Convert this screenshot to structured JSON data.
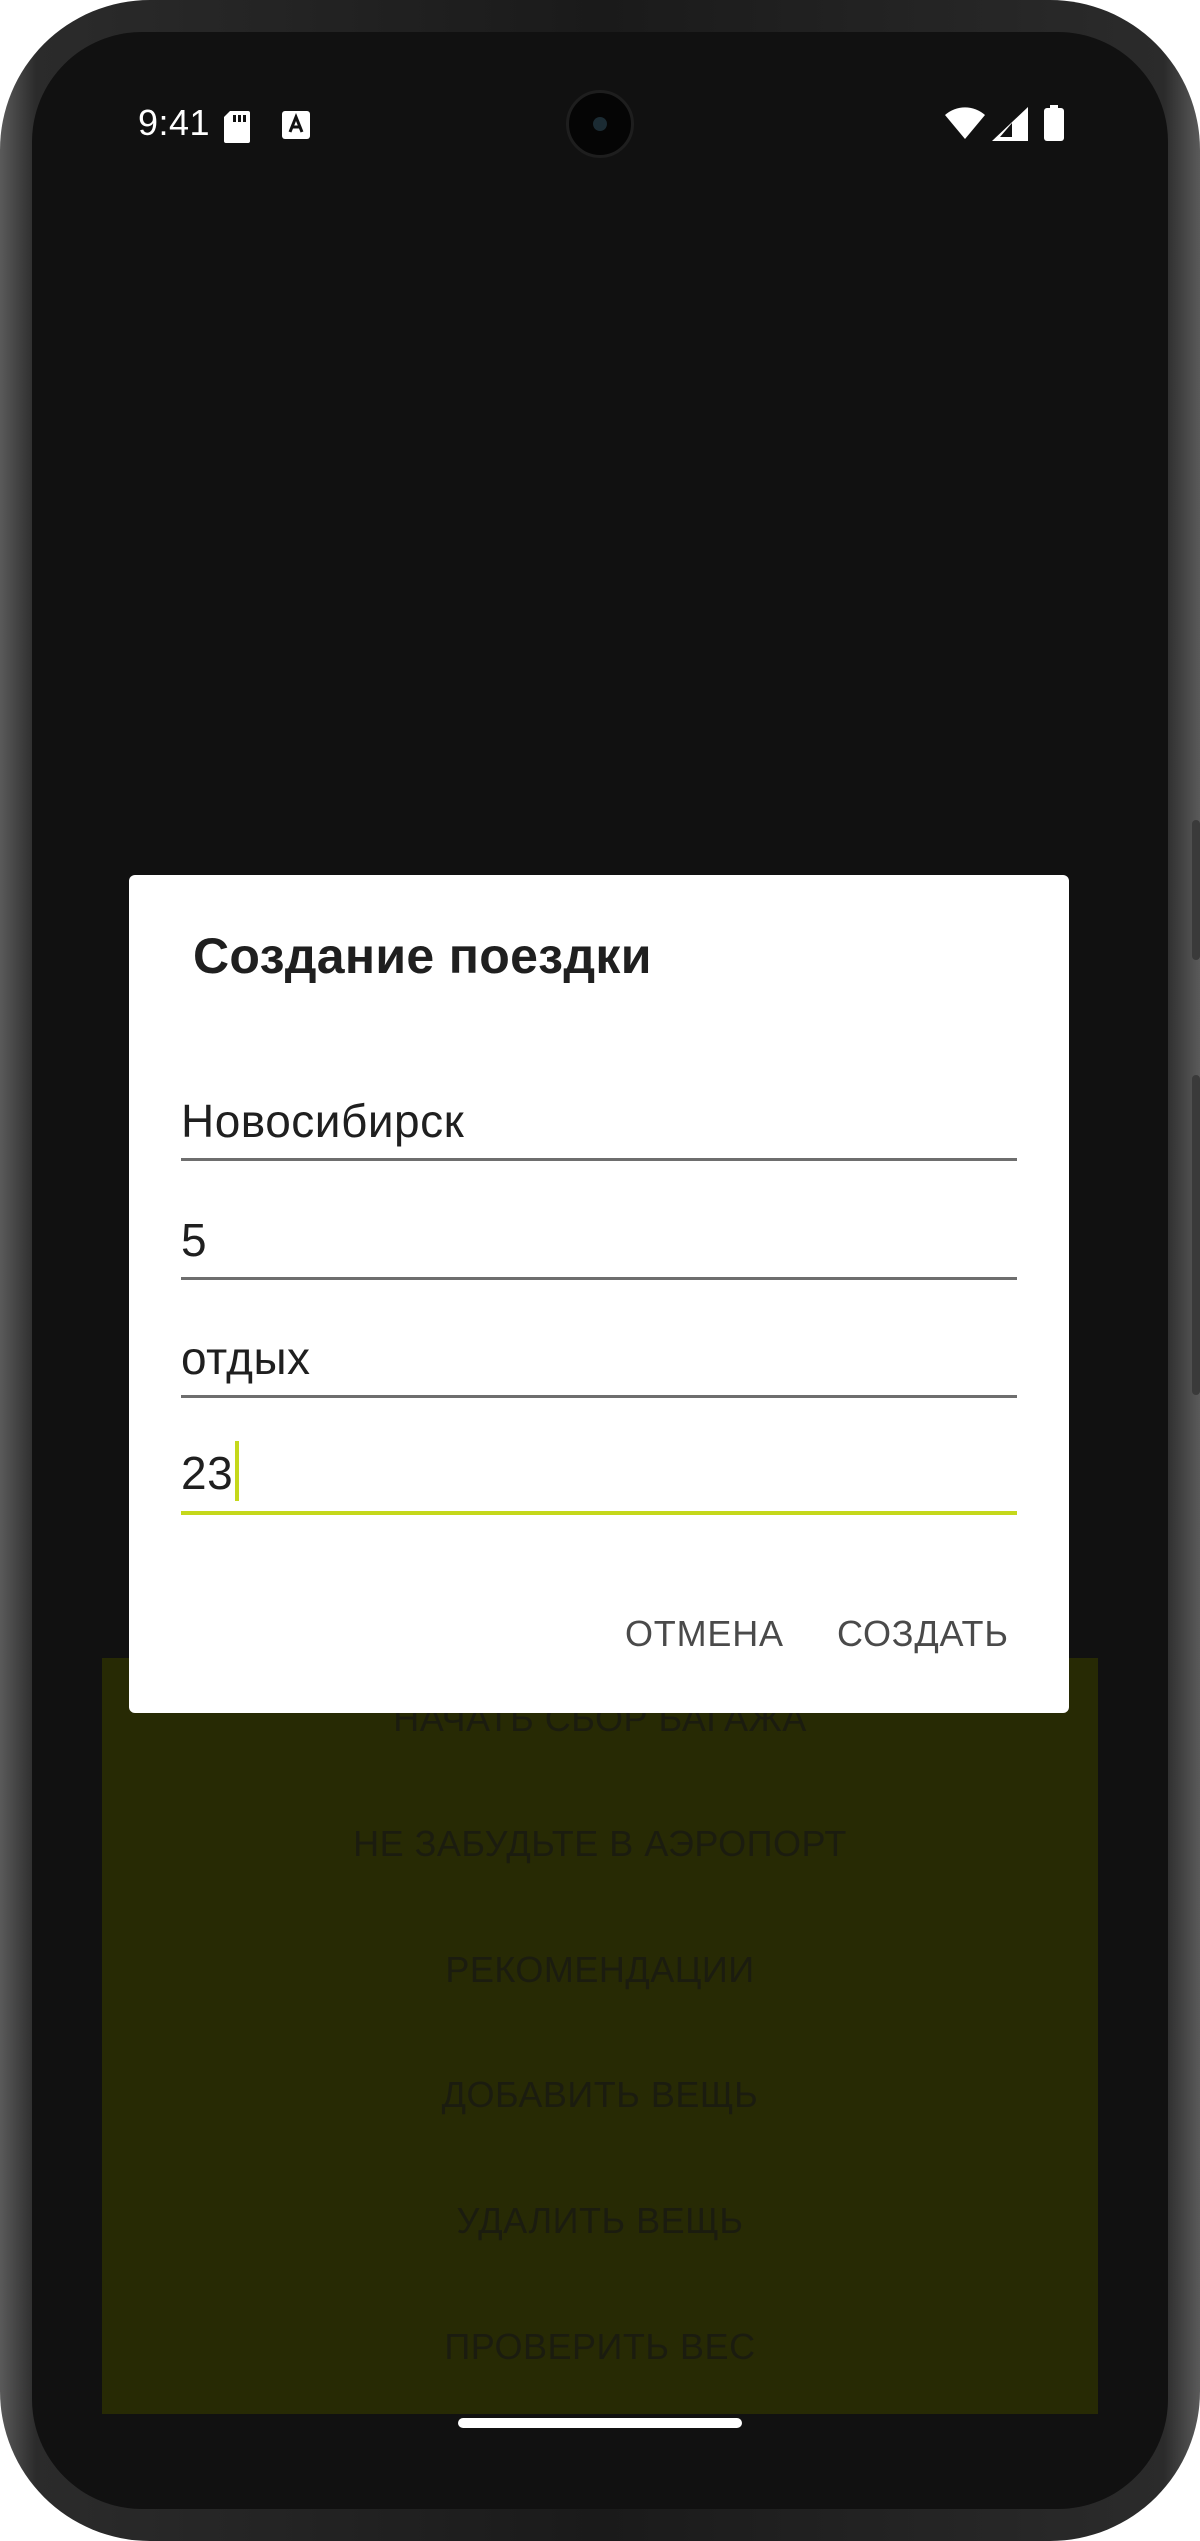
{
  "status_bar": {
    "time": "9:41",
    "icons": [
      "sd-card-icon",
      "a-keyboard-icon",
      "wifi-icon",
      "signal-icon",
      "battery-icon"
    ]
  },
  "background_buttons": [
    "НАЧАТЬ СБОР БАГАЖА",
    "НЕ ЗАБУДЬТЕ В АЭРОПОРТ",
    "РЕКОМЕНДАЦИИ",
    "ДОБАВИТЬ ВЕЩЬ",
    "УДАЛИТЬ ВЕЩЬ",
    "ПРОВЕРИТЬ ВЕС"
  ],
  "dialog": {
    "title": "Создание поездки",
    "fields": [
      {
        "value": "Новосибирск"
      },
      {
        "value": "5"
      },
      {
        "value": "отдых"
      },
      {
        "value": "23",
        "focused": true
      }
    ],
    "cancel_label": "ОТМЕНА",
    "create_label": "СОЗДАТЬ"
  },
  "colors": {
    "accent": "#c5d81b",
    "screen_background": "#111111",
    "panel_background": "#272a04",
    "dialog_background": "#ffffff"
  }
}
